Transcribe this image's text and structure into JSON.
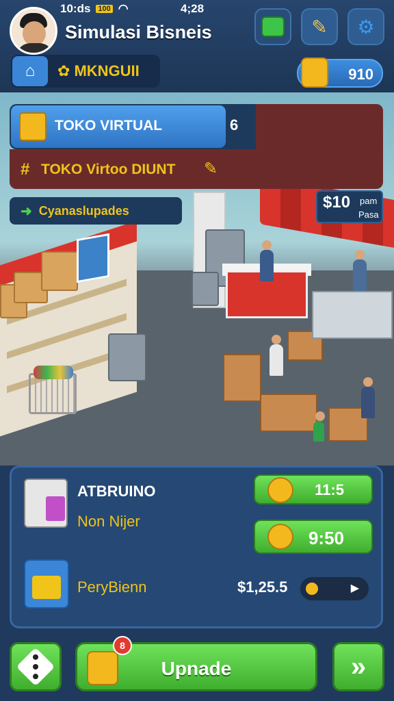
{
  "status_bar": {
    "left_time": "10:ds",
    "battery": "100",
    "right_time": "4;28"
  },
  "header": {
    "title": "Simulasi Bisneis",
    "menu_label": "MKNGUII",
    "coin_value": "910"
  },
  "scene": {
    "shop_tab_label": "TOKO VIRTUAL",
    "shop_tab_count": "6",
    "secondary_label": "TOKO Virtoo DIUNT",
    "secondary_icon": "#",
    "updates_label": "Cyanaslupades",
    "price_main": "$10",
    "price_sub1": "pam",
    "price_sub2": "Pasa"
  },
  "stats": {
    "title": "ATBRUINO",
    "subtitle": "Non Nijer",
    "pill1_value": "11:5",
    "pill2_value": "9:50",
    "row3_label": "PeryBienn",
    "money": "$1,25.5"
  },
  "bottom": {
    "upgrade_label": "Upnade",
    "badge": "8"
  },
  "colors": {
    "accent_green": "#3fae2e",
    "accent_yellow": "#f0c419",
    "panel_blue": "#254875"
  }
}
